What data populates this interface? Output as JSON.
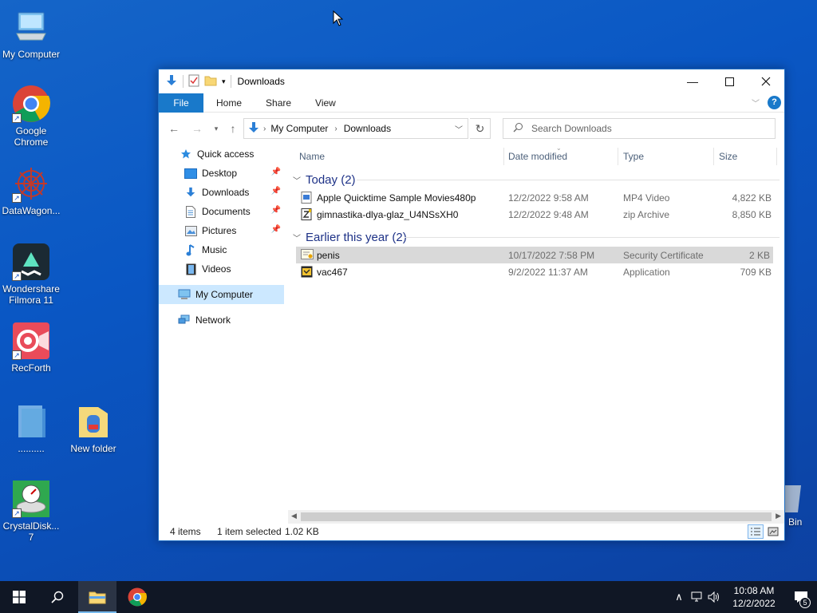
{
  "desktop": {
    "icons": [
      {
        "label": "My Computer"
      },
      {
        "label": "Google Chrome"
      },
      {
        "label": "DataWagon..."
      },
      {
        "label": "Wondershare Filmora 11"
      },
      {
        "label": "RecForth"
      },
      {
        "label": ".........."
      },
      {
        "label": "New folder"
      },
      {
        "label": "CrystalDisk... 7"
      },
      {
        "label": "Bin"
      }
    ]
  },
  "window": {
    "title": "Downloads",
    "ribbon_tabs": [
      "File",
      "Home",
      "Share",
      "View"
    ],
    "address": {
      "crumbs": [
        "My Computer",
        "Downloads"
      ]
    },
    "search": {
      "placeholder": "Search Downloads"
    },
    "nav": {
      "items": [
        {
          "label": "Quick access"
        },
        {
          "label": "Desktop"
        },
        {
          "label": "Downloads"
        },
        {
          "label": "Documents"
        },
        {
          "label": "Pictures"
        },
        {
          "label": "Music"
        },
        {
          "label": "Videos"
        },
        {
          "label": "My Computer"
        },
        {
          "label": "Network"
        }
      ]
    },
    "columns": [
      "Name",
      "Date modified",
      "Type",
      "Size"
    ],
    "groups": [
      {
        "label": "Today (2)",
        "files": [
          {
            "name": "Apple Quicktime Sample Movies480p",
            "date": "12/2/2022 9:58 AM",
            "type": "MP4 Video",
            "size": "4,822 KB"
          },
          {
            "name": "gimnastika-dlya-glaz_U4NSsXH0",
            "date": "12/2/2022 9:48 AM",
            "type": "zip Archive",
            "size": "8,850 KB"
          }
        ]
      },
      {
        "label": "Earlier this year (2)",
        "files": [
          {
            "name": "penis",
            "date": "10/17/2022 7:58 PM",
            "type": "Security Certificate",
            "size": "2 KB"
          },
          {
            "name": "vac467",
            "date": "9/2/2022 11:37 AM",
            "type": "Application",
            "size": "709 KB"
          }
        ]
      }
    ],
    "status": {
      "items": "4 items",
      "selected": "1 item selected",
      "size": "1.02 KB"
    }
  },
  "taskbar": {
    "time": "10:08 AM",
    "date": "12/2/2022",
    "notifications": "5"
  },
  "colors": {
    "accent": "#1979ca",
    "desktop": "#0a57c4",
    "taskbar": "#101725",
    "selection": "#cce8ff"
  }
}
